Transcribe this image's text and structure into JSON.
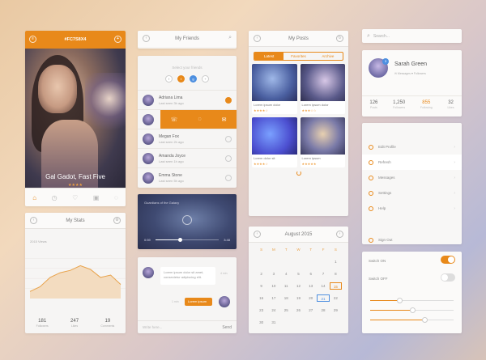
{
  "movie": {
    "header_title": "#FC7S8X4",
    "caption": "Gal Gadot, Fast Five",
    "stars": "★★★★",
    "tabs": [
      "⌂",
      "◷",
      "♡",
      "▣",
      "◌"
    ]
  },
  "friends": {
    "title": "My Friends",
    "subtitle": "Select your friends",
    "dots": [
      "f",
      "t",
      "g",
      "+"
    ],
    "list": [
      {
        "name": "Adriana Lima",
        "sub": "Last seen 3h ago",
        "checked": true
      },
      {
        "name": "",
        "sub": "",
        "checked": false
      },
      {
        "name": "Megan Fox",
        "sub": "Last seen 2h ago",
        "checked": false
      },
      {
        "name": "Amanda Joyce",
        "sub": "Last seen 1h ago",
        "checked": false
      },
      {
        "name": "Emma Stone",
        "sub": "Last seen 5h ago",
        "checked": false
      }
    ],
    "actions": [
      "☏",
      "◌",
      "✉"
    ]
  },
  "video": {
    "title": "Guardians of the Galaxy",
    "time_start": "0:59",
    "time_end": "3:48",
    "progress": 0.38
  },
  "chat": {
    "message1": "Lorem ipsum dolor sit amet, consectetur adipiscing elit.",
    "message2": "Lorem ipsum",
    "time1": "4 min",
    "time2": "1 min",
    "input_placeholder": "Write here...",
    "send_label": "Send"
  },
  "posts": {
    "title": "My Posts",
    "segments": [
      "Latest",
      "Favorites",
      "Archive"
    ],
    "tiles": [
      {
        "caption": "Lorem ipsum dolor",
        "stars": "★★★★☆"
      },
      {
        "caption": "Lorem ipsum dolor",
        "stars": "★★★☆☆"
      },
      {
        "caption": "Lorem dolor sit",
        "stars": "★★★★☆"
      },
      {
        "caption": "Lorem ipsum",
        "stars": "★★★★★"
      }
    ]
  },
  "calendar": {
    "title": "August 2015",
    "dow": [
      "S",
      "M",
      "T",
      "W",
      "T",
      "F",
      "S"
    ],
    "days": [
      "",
      "",
      "",
      "",
      "",
      "",
      "1",
      "2",
      "3",
      "4",
      "5",
      "6",
      "7",
      "8",
      "9",
      "10",
      "11",
      "12",
      "13",
      "14",
      "15",
      "16",
      "17",
      "18",
      "19",
      "20",
      "21",
      "22",
      "23",
      "24",
      "25",
      "26",
      "27",
      "28",
      "29",
      "30",
      "31"
    ],
    "today": "15",
    "selected": "21"
  },
  "search": {
    "placeholder": "Search..."
  },
  "profile": {
    "name": "Sarah Green",
    "meta": "✉ Messages   ♥ Followers",
    "badge": "3",
    "stats": [
      {
        "value": "126",
        "label": "Posts"
      },
      {
        "value": "1,250",
        "label": "Followers"
      },
      {
        "value": "855",
        "label": "Following"
      },
      {
        "value": "32",
        "label": "Likes"
      }
    ]
  },
  "menu": {
    "items": [
      "Edit Profile",
      "Refresh",
      "Messages",
      "Settings",
      "Help"
    ],
    "active_index": 1,
    "sign_out": "Sign Out"
  },
  "settings": {
    "switch_on_label": "Switch ON",
    "switch_off_label": "Switch OFF",
    "slider1": 0.35,
    "slider2": 0.5,
    "slider3": 0.65
  },
  "stats_card": {
    "title": "My Stats",
    "legend": "2015  Views",
    "values": [
      {
        "value": "181",
        "label": "Followers"
      },
      {
        "value": "247",
        "label": "Likes"
      },
      {
        "value": "19",
        "label": "Comments"
      }
    ]
  },
  "chart_data": {
    "type": "area",
    "x": [
      1,
      2,
      3,
      4,
      5,
      6,
      7,
      8,
      9,
      10
    ],
    "values": [
      15,
      25,
      45,
      55,
      60,
      70,
      62,
      45,
      50,
      30
    ],
    "ylim": [
      0,
      100
    ],
    "grid": true
  }
}
